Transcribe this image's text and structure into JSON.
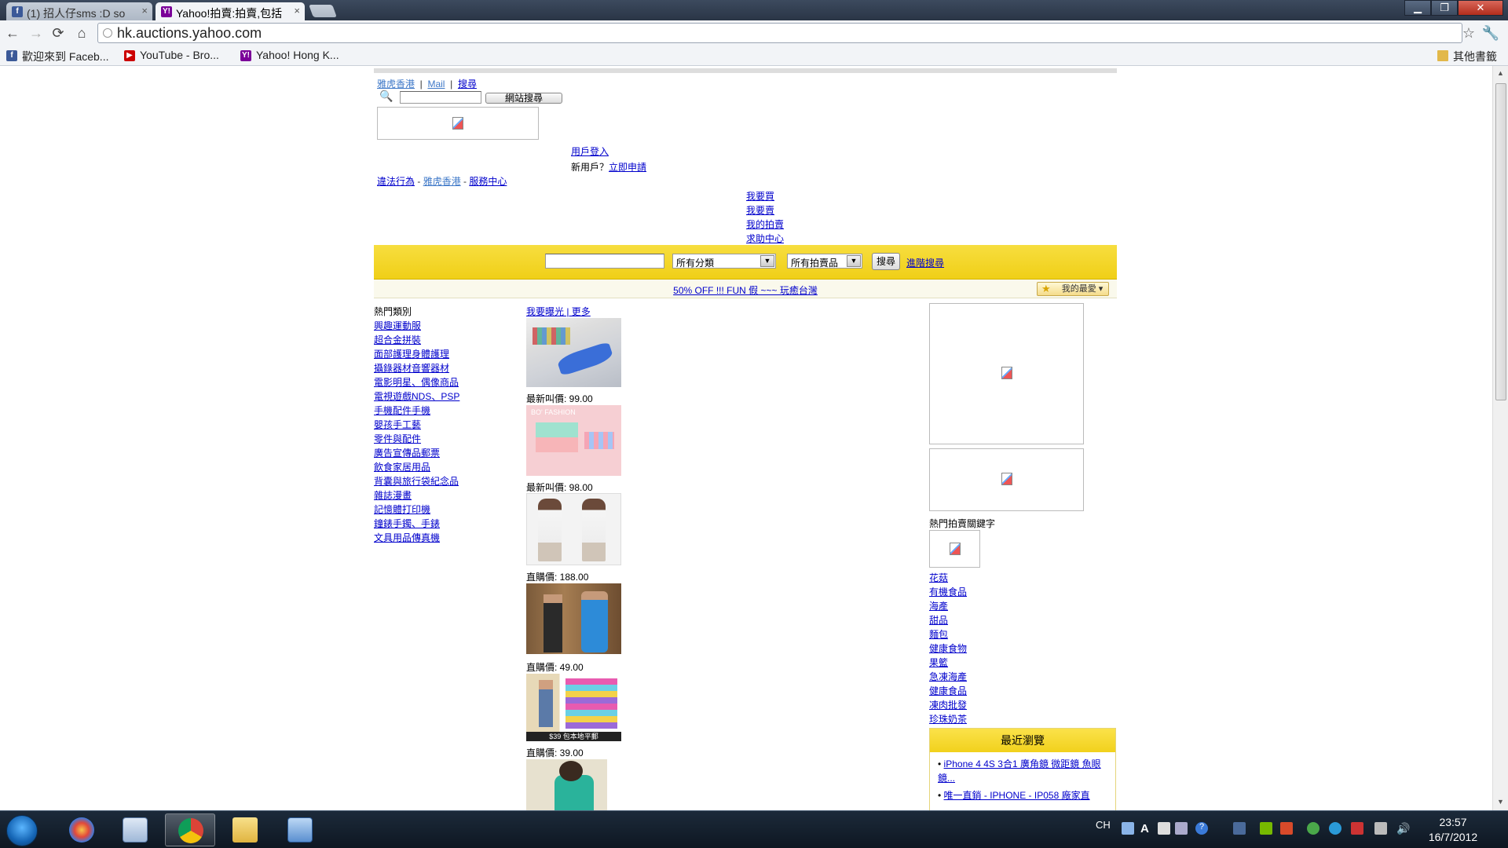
{
  "browser": {
    "tabs": [
      {
        "title": "(1) 招人仔sms :D so",
        "favicon": "facebook-icon",
        "active": false
      },
      {
        "title": "Yahoo!拍賣:拍賣,包括",
        "favicon": "yahoo-icon",
        "active": true
      }
    ],
    "address": "hk.auctions.yahoo.com",
    "bookmarks": [
      {
        "label": "歡迎來到 Faceb...",
        "icon": "facebook-icon",
        "color": "#3b5998"
      },
      {
        "label": "YouTube - Bro...",
        "icon": "youtube-icon",
        "color": "#cc0000"
      },
      {
        "label": "Yahoo! Hong K...",
        "icon": "yahoo-icon",
        "color": "#7b0099"
      }
    ],
    "other_bookmarks": "其他書籤"
  },
  "header": {
    "top_links": [
      "雅虎香港",
      "Mail",
      "搜尋"
    ],
    "site_search_button": "網站搜尋",
    "login": "用戶登入",
    "new_user_prefix": "新用戶？",
    "register": "立即申請",
    "footer_links": [
      "違法行為",
      "雅虎香港",
      "服務中心"
    ],
    "nav_links": [
      "我要買",
      "我要賣",
      "我的拍賣",
      "求助中心"
    ]
  },
  "searchbar": {
    "category_value": "所有分類",
    "type_value": "所有拍賣品",
    "search_button": "搜尋",
    "advanced_link": "進階搜尋"
  },
  "promo": {
    "text": "50% OFF !!! FUN 假 ~~~ 玩癒台灣",
    "favorites": "我的最愛"
  },
  "categories": {
    "title": "熱門類別",
    "items": [
      "興趣運動服",
      "超合金拼裝",
      "面部護理身體護理",
      "攝錄器材音響器材",
      "電影明星、偶像商品",
      "電視遊戲NDS、PSP",
      "手機配件手機",
      "嬰孩手工藝",
      "零件與配件",
      "廣告宣傳品郵票",
      "飲食家居用品",
      "背囊與旅行袋紀念品",
      "雜誌漫畫",
      "記憶體打印機",
      "鐘錶手鐲、手錶",
      "文具用品傳真機"
    ]
  },
  "featured": {
    "header": "我要曝光 | 更多",
    "items": [
      {
        "price": "最新叫價: 99.00"
      },
      {
        "price": "最新叫價: 98.00"
      },
      {
        "price": "直購價: 188.00"
      },
      {
        "price": "直購價: 49.00"
      },
      {
        "price": "直購價: 39.00"
      }
    ],
    "img5_caption": "$39 包本地平郵",
    "img2_caption": "BO' FASHION"
  },
  "keywords": {
    "title": "熱門拍賣關鍵字",
    "items": [
      "花菇",
      "有機食品",
      "海產",
      "甜品",
      "麵包",
      "健康食物",
      "果籃",
      "急凍海產",
      "健康食品",
      "凍肉批發",
      "珍珠奶茶"
    ]
  },
  "recent": {
    "title": "最近瀏覽",
    "items": [
      "iPhone 4 4S 3合1 廣角鏡 微距鏡 魚眼鏡...",
      "唯一直銷 - IPHONE - IP058 廠家直"
    ]
  },
  "taskbar": {
    "lang": "CH",
    "time": "23:57",
    "date": "16/7/2012"
  }
}
